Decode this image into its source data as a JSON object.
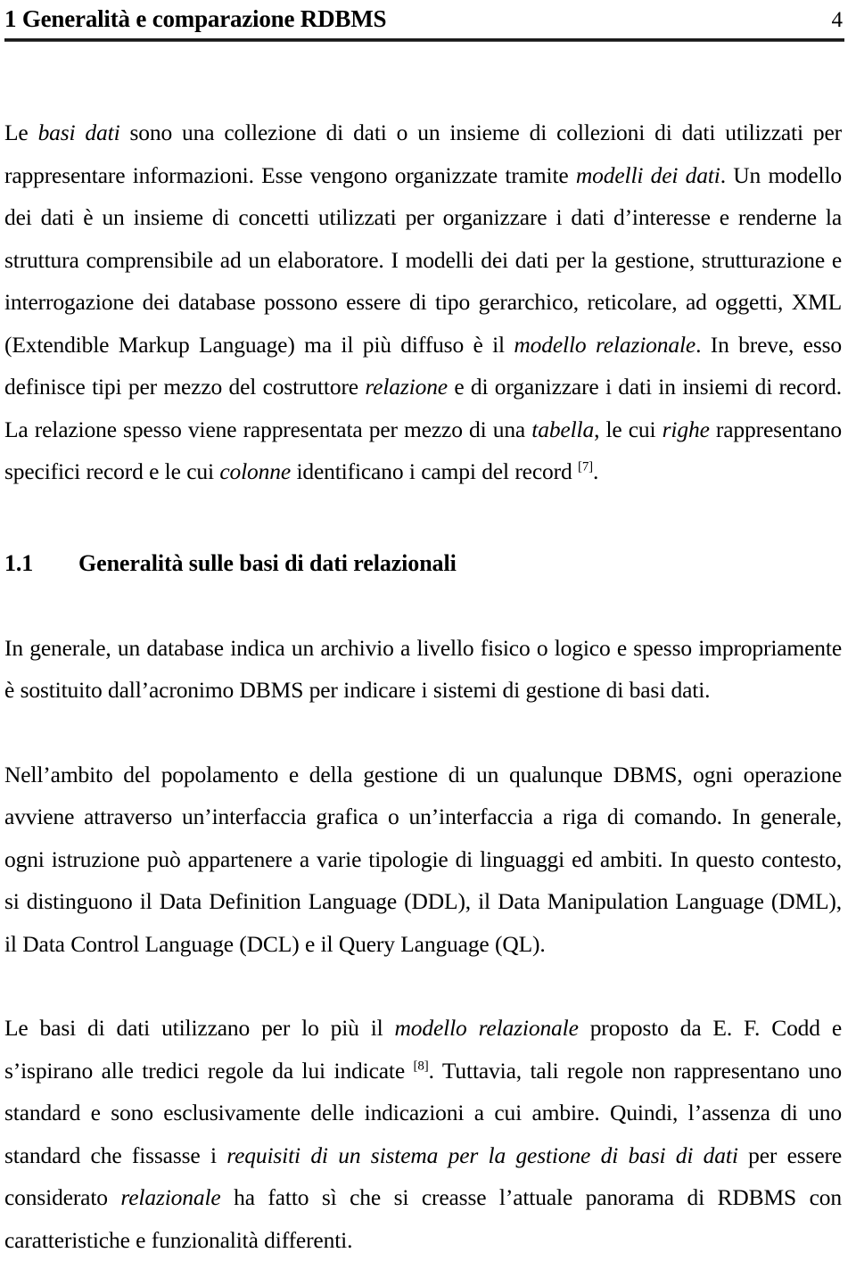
{
  "header": {
    "title": "1 Generalità e comparazione RDBMS",
    "page_number": "4"
  },
  "paragraphs": {
    "p1": {
      "s1": "Le ",
      "i1": "basi dati",
      "s2": " sono una collezione di dati o un insieme di collezioni di dati utilizzati per rappresentare informazioni. Esse vengono organizzate tramite ",
      "i2": "modelli dei dati",
      "s3": ". Un modello dei dati è un insieme di concetti utilizzati per organizzare i dati d’interesse e renderne la struttura comprensibile ad un elaboratore. I modelli dei dati per la gestione, strutturazione e interrogazione dei database possono essere di tipo gerarchico, reticolare, ad oggetti, XML (Extendible Markup Language) ma il più diffuso è il ",
      "i3": "modello relazionale",
      "s4": ". In breve, esso definisce tipi per mezzo del costruttore ",
      "i4": "relazione",
      "s5": " e di organizzare i dati in insiemi di record. La relazione spesso viene rappresentata per mezzo di una ",
      "i5": "tabella",
      "s6": ", le cui ",
      "i6": "righe",
      "s7": " rappresentano specifici record e le cui ",
      "i7": "colonne",
      "s8": " identificano i campi del record ",
      "cite1": "[7]",
      "s9": "."
    },
    "p2": {
      "s1": "In generale, un database indica un archivio a livello fisico o logico e spesso impropriamente è sostituito dall’acronimo DBMS per indicare i sistemi di gestione di basi dati."
    },
    "p3": {
      "s1": "Nell’ambito del popolamento e della gestione di un qualunque DBMS, ogni operazione avviene attraverso un’interfaccia grafica o un’interfaccia a riga di comando. In generale, ogni istruzione può appartenere a varie tipologie di linguaggi ed ambiti. In questo contesto, si distinguono il Data Definition Language (DDL), il Data Manipulation Language (DML), il Data Control Language (DCL) e il Query Language (QL)."
    },
    "p4": {
      "s1": "Le basi di dati utilizzano per lo più il ",
      "i1": "modello relazionale",
      "s2": " proposto da E. F. Codd e s’ispirano alle tredici regole da lui indicate ",
      "cite1": "[8]",
      "s3": ". Tuttavia, tali regole non rappresentano uno standard e sono esclusivamente delle indicazioni a cui ambire. Quindi, l’assenza di uno standard che fissasse i ",
      "i2": "requisiti di un sistema per la gestione di basi di dati",
      "s4": " per essere considerato ",
      "i3": "relazionale",
      "s5": " ha fatto sì che si creasse l’attuale panorama di RDBMS con caratteristiche e funzionalità differenti."
    }
  },
  "section": {
    "number": "1.1",
    "title": "Generalità sulle basi di dati relazionali"
  }
}
